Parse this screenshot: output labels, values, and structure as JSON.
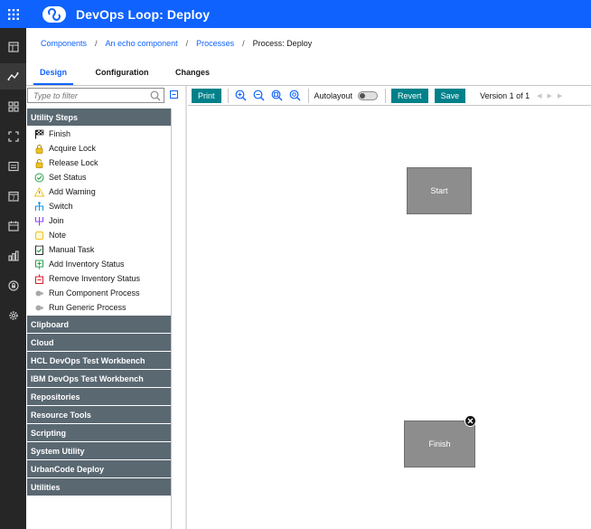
{
  "app": {
    "title": "DevOps Loop: Deploy"
  },
  "sidenav": {
    "items": [
      "dashboard-icon",
      "deploy-icon",
      "apps-icon",
      "components-icon",
      "document-icon",
      "calendar-icon",
      "schedule-icon",
      "reports-icon",
      "security-icon",
      "settings-icon"
    ],
    "active": "deploy-icon"
  },
  "breadcrumb": {
    "items": [
      "Components",
      "An echo component",
      "Processes"
    ],
    "separator": "/",
    "current": "Process: Deploy"
  },
  "tabs": [
    {
      "label": "Design",
      "active": true
    },
    {
      "label": "Configuration",
      "active": false
    },
    {
      "label": "Changes",
      "active": false
    }
  ],
  "filter": {
    "placeholder": "Type to filter",
    "value": ""
  },
  "palette": {
    "open_category": "Utility Steps",
    "steps": [
      {
        "label": "Finish",
        "icon": "checkered-flag-icon"
      },
      {
        "label": "Acquire Lock",
        "icon": "lock-icon"
      },
      {
        "label": "Release Lock",
        "icon": "unlock-icon"
      },
      {
        "label": "Set Status",
        "icon": "check-circle-icon"
      },
      {
        "label": "Add Warning",
        "icon": "warning-icon"
      },
      {
        "label": "Switch",
        "icon": "switch-icon"
      },
      {
        "label": "Join",
        "icon": "join-icon"
      },
      {
        "label": "Note",
        "icon": "note-icon"
      },
      {
        "label": "Manual Task",
        "icon": "manual-task-icon"
      },
      {
        "label": "Add Inventory Status",
        "icon": "add-inventory-icon"
      },
      {
        "label": "Remove Inventory Status",
        "icon": "remove-inventory-icon"
      },
      {
        "label": "Run Component Process",
        "icon": "run-process-icon"
      },
      {
        "label": "Run Generic Process",
        "icon": "run-process-icon"
      }
    ],
    "categories": [
      "Clipboard",
      "Cloud",
      "HCL DevOps Test Workbench",
      "IBM DevOps Test Workbench",
      "Repositories",
      "Resource Tools",
      "Scripting",
      "System Utility",
      "UrbanCode Deploy",
      "Utilities"
    ]
  },
  "toolbar": {
    "print_label": "Print",
    "zoom_icons": [
      "zoom-in-icon",
      "zoom-out-icon",
      "zoom-fit-icon",
      "zoom-reset-icon"
    ],
    "autolayout_label": "Autolayout",
    "autolayout_on": false,
    "revert_label": "Revert",
    "save_label": "Save",
    "version_label": "Version 1 of 1"
  },
  "canvas": {
    "nodes": [
      {
        "label": "Start"
      },
      {
        "label": "Finish",
        "has_remove": true
      }
    ]
  },
  "colors": {
    "header": "#0f62fe",
    "sidenav": "#262626",
    "category": "#5a6872",
    "button": "#00818a",
    "node": "#8d8d8d"
  }
}
